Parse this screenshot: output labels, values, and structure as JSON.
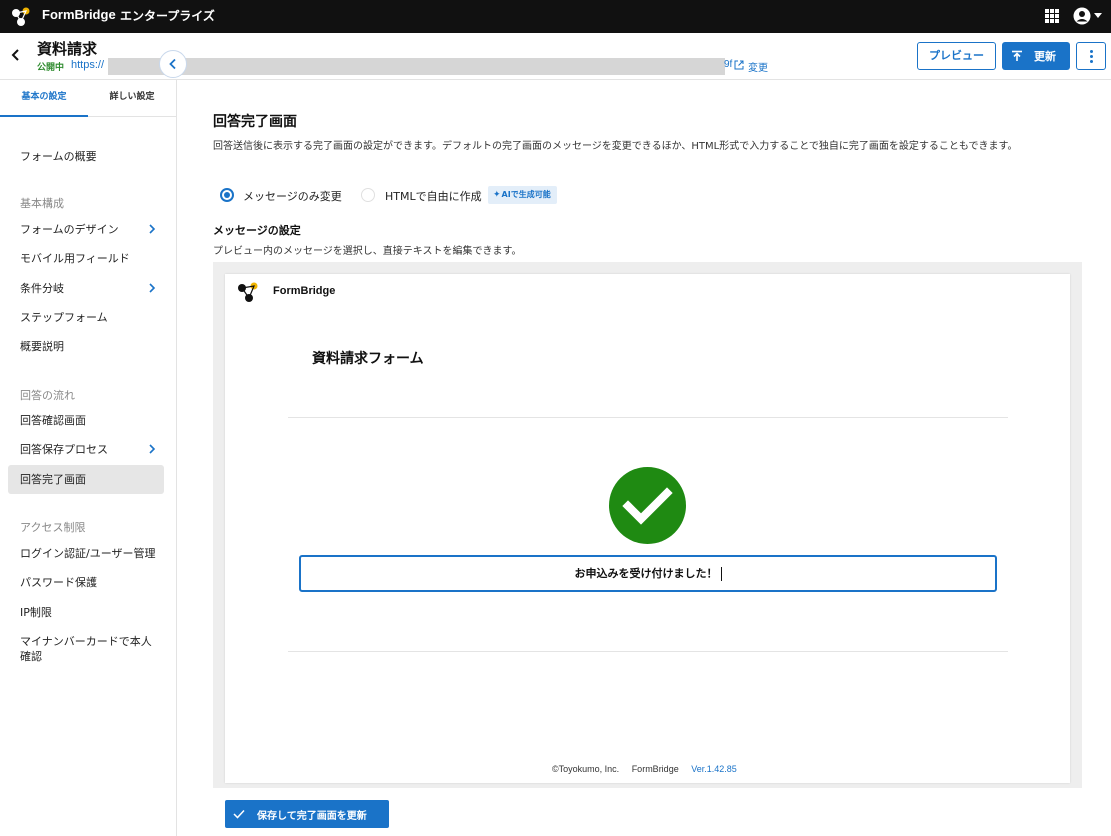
{
  "app": {
    "brand": "FormBridge",
    "plan": "エンタープライズ"
  },
  "header": {
    "title": "資料請求",
    "status": "公開中",
    "url_prefix": "https://",
    "url_suffix": "9f",
    "change_label": "変更",
    "preview_label": "プレビュー",
    "update_label": "更新"
  },
  "sidebar": {
    "tabs": [
      {
        "label": "基本の設定"
      },
      {
        "label": "詳しい設定"
      }
    ],
    "overview": "フォームの概要",
    "groups": [
      "基本構成",
      "回答の流れ",
      "アクセス制限"
    ],
    "items": [
      {
        "label": "フォームのデザイン"
      },
      {
        "label": "モバイル用フィールド"
      },
      {
        "label": "条件分岐"
      },
      {
        "label": "ステップフォーム"
      },
      {
        "label": "概要説明"
      },
      {
        "label": "回答確認画面"
      },
      {
        "label": "回答保存プロセス"
      },
      {
        "label": "回答完了画面"
      },
      {
        "label": "ログイン認証/ユーザー管理"
      },
      {
        "label": "パスワード保護"
      },
      {
        "label": "IP制限"
      },
      {
        "label": "マイナンバーカードで本人確認"
      }
    ]
  },
  "main": {
    "title": "回答完了画面",
    "description": "回答送信後に表示する完了画面の設定ができます。デフォルトの完了画面のメッセージを変更できるほか、HTML形式で入力することで独自に完了画面を設定することもできます。",
    "options": [
      {
        "label": "メッセージのみ変更",
        "selected": true
      },
      {
        "label": "HTMLで自由に作成",
        "selected": false
      }
    ],
    "ai_badge": "AIで生成可能",
    "section_title": "メッセージの設定",
    "section_desc": "プレビュー内のメッセージを選択し、直接テキストを編集できます。",
    "preview": {
      "brand": "FormBridge",
      "form_title": "資料請求フォーム",
      "message": "お申込みを受け付けました！",
      "footer_copyright": "©Toyokumo, Inc.",
      "footer_brand": "FormBridge",
      "footer_version": "Ver.1.42.85"
    },
    "save_label": "保存して完了画面を更新"
  },
  "colors": {
    "accent": "#1a73c8",
    "success": "#1f8a12",
    "topbar": "#111111",
    "status_green": "#2e8b2e"
  },
  "icons": [
    "formbridge-logo-icon",
    "apps-grid-icon",
    "user-icon",
    "back-arrow-icon",
    "external-link-icon",
    "upload-icon",
    "more-vertical-icon",
    "chevron-left-icon",
    "chevron-right-icon",
    "sparkle-icon",
    "checkmark-icon"
  ]
}
